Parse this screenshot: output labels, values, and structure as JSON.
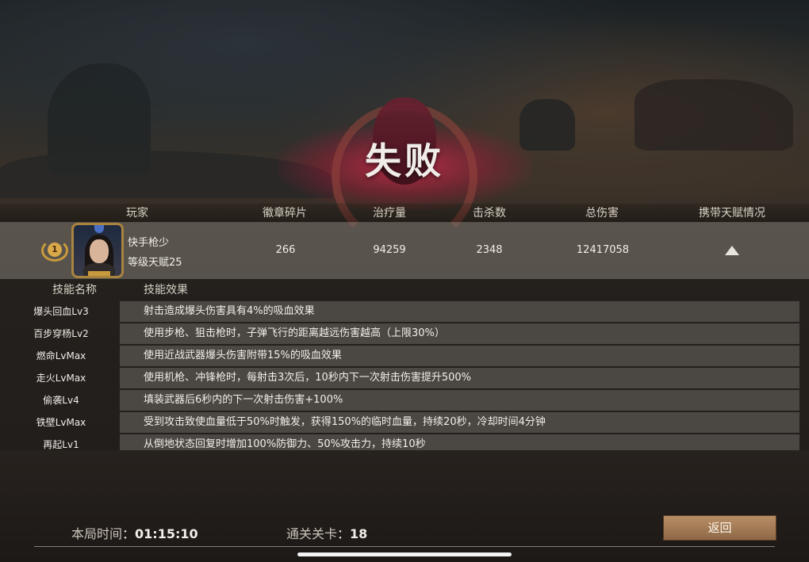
{
  "result": {
    "title": "失败"
  },
  "table": {
    "headers": [
      "玩家",
      "徽章碎片",
      "治疗量",
      "击杀数",
      "总伤害",
      "携带天赋情况"
    ]
  },
  "player": {
    "rank": "1",
    "name": "快手枪少",
    "level_text": "等级天赋25",
    "badge_fragments": "266",
    "healing": "94259",
    "kills": "2348",
    "total_damage": "12417058"
  },
  "skills": {
    "header_name": "技能名称",
    "header_effect": "技能效果",
    "items": [
      {
        "name": "爆头回血Lv3",
        "effect": "射击造成爆头伤害具有4%的吸血效果"
      },
      {
        "name": "百步穿杨Lv2",
        "effect": "使用步枪、狙击枪时，子弹飞行的距离越远伤害越高（上限30%）"
      },
      {
        "name": "燃命LvMax",
        "effect": "使用近战武器爆头伤害附带15%的吸血效果"
      },
      {
        "name": "走火LvMax",
        "effect": "使用机枪、冲锋枪时，每射击3次后，10秒内下一次射击伤害提升500%"
      },
      {
        "name": "偷袭Lv4",
        "effect": "填装武器后6秒内的下一次射击伤害+100%"
      },
      {
        "name": "铁壁LvMax",
        "effect": "受到攻击致使血量低于50%时触发，获得150%的临时血量，持续20秒，冷却时间4分钟"
      },
      {
        "name": "再起Lv1",
        "effect": "从倒地状态回复时增加100%防御力、50%攻击力，持续10秒"
      }
    ]
  },
  "footer": {
    "time_label": "本局时间",
    "time_value": "01:15:10",
    "level_label": "通关关卡",
    "level_value": "18",
    "colon": "：",
    "back_label": "返回"
  },
  "colors": {
    "defeat_glow": "#dc2850",
    "button": "#a47c58",
    "frame_gold": "#a9843e"
  },
  "icons": {
    "expand": "triangle-up-icon",
    "rank": "laurel-rank-icon"
  }
}
